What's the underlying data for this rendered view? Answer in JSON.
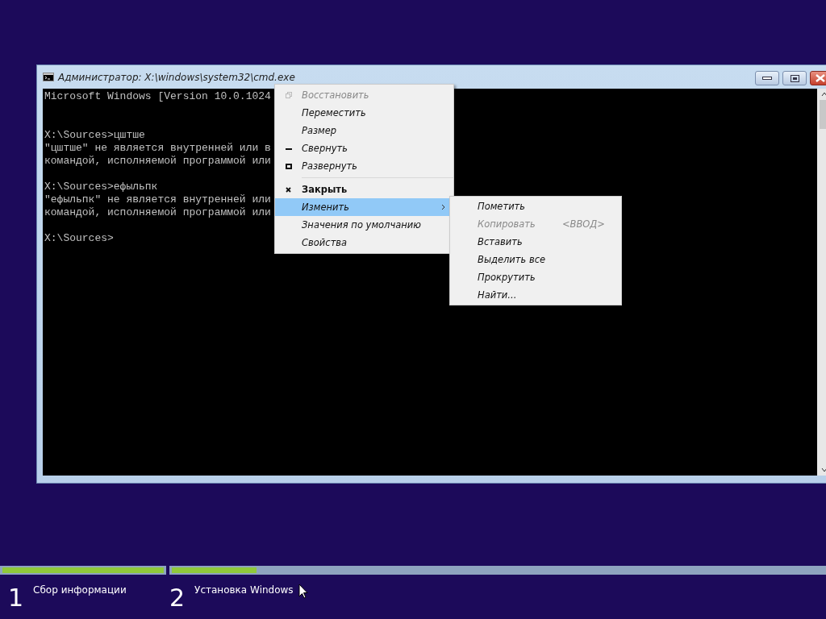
{
  "window": {
    "title": "Администратор: X:\\windows\\system32\\cmd.exe"
  },
  "console": {
    "blocks": [
      [
        "Microsoft Windows [Version 10.0.1024"
      ],
      [
        "X:\\Sources>цштше",
        "\"цштше\" не является внутренней или в",
        "командой, исполняемой программой или"
      ],
      [
        "X:\\Sources>ефыльпк",
        "\"ефыльпк\" не является внутренней или",
        "командой, исполняемой программой или"
      ],
      [
        "X:\\Sources>"
      ]
    ]
  },
  "system_menu": {
    "items": [
      {
        "kind": "restore",
        "label": "Восстановить",
        "disabled": true,
        "selected": false,
        "default": false
      },
      {
        "kind": "plain",
        "label": "Переместить",
        "disabled": false,
        "selected": false,
        "default": false
      },
      {
        "kind": "plain",
        "label": "Размер",
        "disabled": false,
        "selected": false,
        "default": false
      },
      {
        "kind": "minimize",
        "label": "Свернуть",
        "disabled": false,
        "selected": false,
        "default": false
      },
      {
        "kind": "maximize",
        "label": "Развернуть",
        "disabled": false,
        "selected": false,
        "default": false
      },
      {
        "kind": "separator"
      },
      {
        "kind": "close",
        "label": "Закрыть",
        "disabled": false,
        "selected": false,
        "default": true
      },
      {
        "kind": "submenu",
        "label": "Изменить",
        "disabled": false,
        "selected": true,
        "default": false
      },
      {
        "kind": "plain",
        "label": "Значения по умолчанию",
        "disabled": false,
        "selected": false,
        "default": false
      },
      {
        "kind": "plain",
        "label": "Свойства",
        "disabled": false,
        "selected": false,
        "default": false
      }
    ]
  },
  "edit_submenu": {
    "items": [
      {
        "label": "Пометить",
        "disabled": false
      },
      {
        "label": "Копировать",
        "shortcut": "<ВВОД>",
        "disabled": true
      },
      {
        "label": "Вставить",
        "disabled": false
      },
      {
        "label": "Выделить все",
        "disabled": false
      },
      {
        "label": "Прокрутить",
        "disabled": false
      },
      {
        "label": "Найти...",
        "disabled": false
      }
    ]
  },
  "setup_progress": {
    "steps": [
      {
        "number": "1",
        "label": "Сбор информации",
        "level": 1
      },
      {
        "number": "2",
        "label": "Установка Windows",
        "level": 0.13
      }
    ]
  }
}
